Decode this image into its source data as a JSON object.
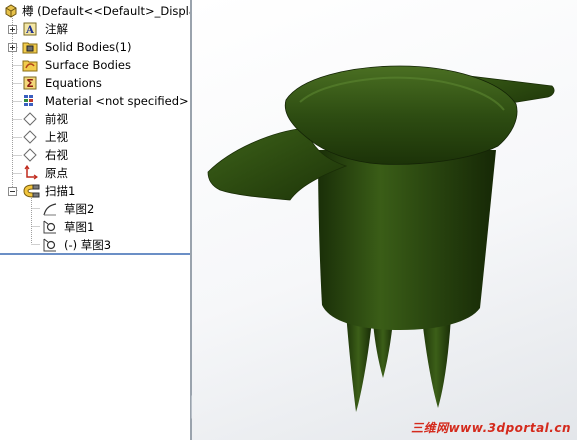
{
  "tree": {
    "root": "樽 (Default<<Default>_Display",
    "items": [
      {
        "label": "注解"
      },
      {
        "label": "Solid Bodies(1)"
      },
      {
        "label": "Surface Bodies"
      },
      {
        "label": "Equations"
      },
      {
        "label": "Material <not specified>"
      },
      {
        "label": "前视"
      },
      {
        "label": "上视"
      },
      {
        "label": "右视"
      },
      {
        "label": "原点"
      },
      {
        "label": "扫描1"
      },
      {
        "label": "草图2"
      },
      {
        "label": "草图1"
      },
      {
        "label": "(-) 草图3"
      }
    ]
  },
  "viewport": {
    "watermark": "三维网www.3dportal.cn",
    "model_color": "#2d4a12"
  }
}
